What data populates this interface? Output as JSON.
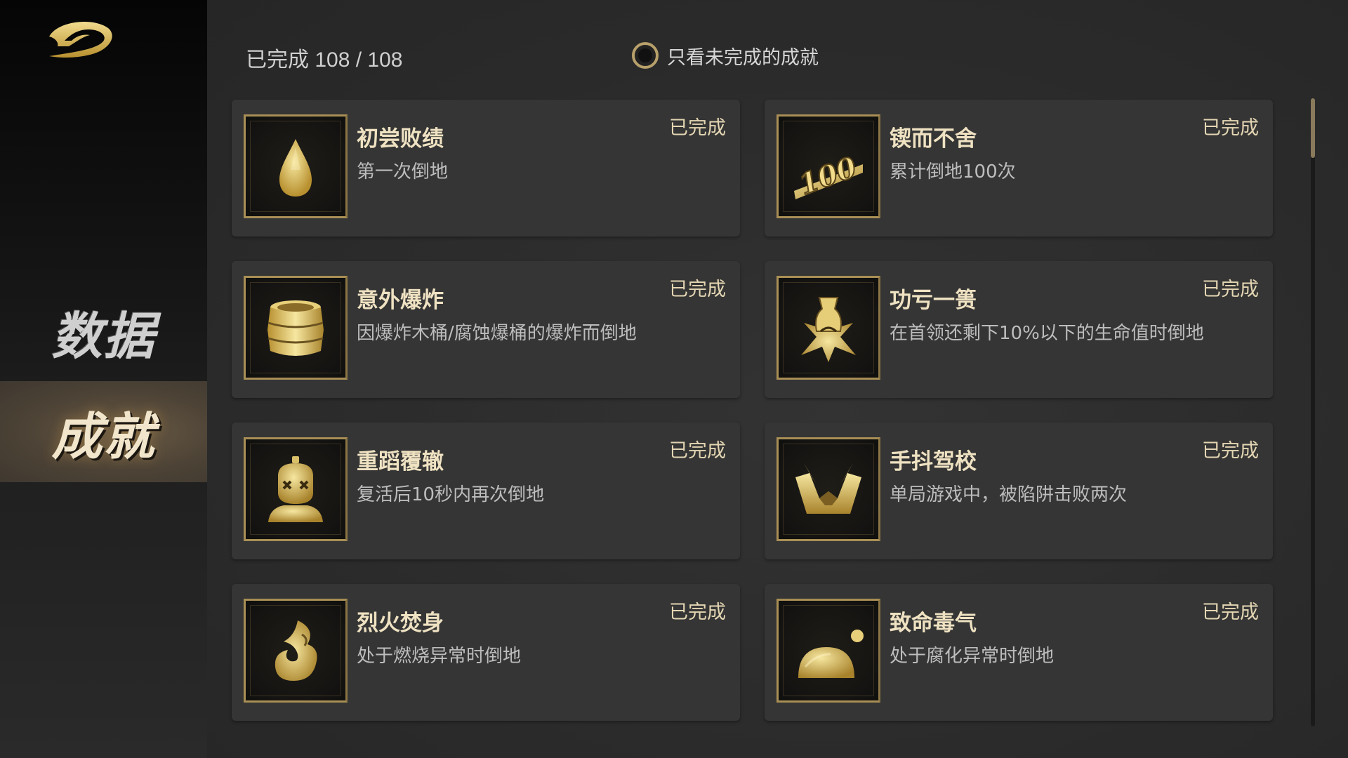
{
  "sidebar": {
    "items": [
      {
        "label": "数据",
        "active": false
      },
      {
        "label": "成就",
        "active": true
      }
    ]
  },
  "header": {
    "progress_text": "已完成 108 / 108",
    "filter_label": "只看未完成的成就",
    "filter_checked": false
  },
  "colors": {
    "accent_gold": "#c9a94a",
    "card_bg": "#353535",
    "active_tab": "#4d4336"
  },
  "achievements": [
    {
      "title": "初尝败绩",
      "desc": "第一次倒地",
      "status": "已完成",
      "icon": "drop-icon"
    },
    {
      "title": "锲而不舍",
      "desc": "累计倒地100次",
      "status": "已完成",
      "icon": "hundred-badge-icon"
    },
    {
      "title": "意外爆炸",
      "desc": "因爆炸木桶/腐蚀爆桶的爆炸而倒地",
      "status": "已完成",
      "icon": "barrel-icon"
    },
    {
      "title": "功亏一篑",
      "desc": "在首领还剩下10%以下的生命值时倒地",
      "status": "已完成",
      "icon": "vase-burst-icon"
    },
    {
      "title": "重蹈覆辙",
      "desc": "复活后10秒内再次倒地",
      "status": "已完成",
      "icon": "knocked-out-figure-icon"
    },
    {
      "title": "手抖驾校",
      "desc": "单局游戏中，被陷阱击败两次",
      "status": "已完成",
      "icon": "spike-trap-icon"
    },
    {
      "title": "烈火焚身",
      "desc": "处于燃烧异常时倒地",
      "status": "已完成",
      "icon": "flame-icon"
    },
    {
      "title": "致命毒气",
      "desc": "处于腐化异常时倒地",
      "status": "已完成",
      "icon": "poison-blob-icon"
    }
  ]
}
